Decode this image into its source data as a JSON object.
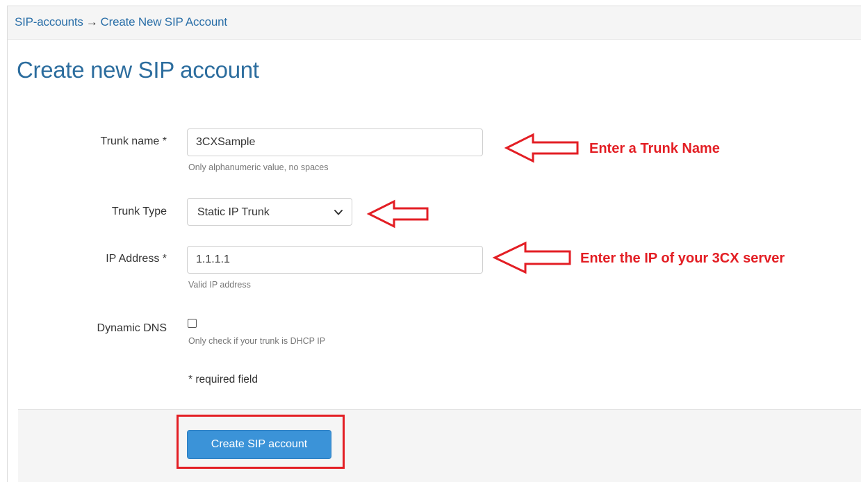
{
  "breadcrumb": {
    "parent": "SIP-accounts",
    "separator": "→",
    "current": "Create New SIP Account"
  },
  "page": {
    "title": "Create new SIP account"
  },
  "form": {
    "trunk_name": {
      "label": "Trunk name *",
      "value": "3CXSample",
      "help": "Only alphanumeric value, no spaces"
    },
    "trunk_type": {
      "label": "Trunk Type",
      "selected": "Static IP Trunk"
    },
    "ip_address": {
      "label": "IP Address *",
      "value": "1.1.1.1",
      "help": "Valid IP address"
    },
    "dynamic_dns": {
      "label": "Dynamic DNS",
      "checked": false,
      "help": "Only check if your trunk is DHCP IP"
    },
    "required_note": "* required field",
    "submit_label": "Create SIP account"
  },
  "annotations": {
    "trunk_name": "Enter a Trunk Name",
    "ip_address": "Enter the IP of your 3CX server",
    "color": "#e31e24"
  },
  "colors": {
    "title": "#2c6d9e",
    "link": "#2a6fa8",
    "button": "#3b93d8",
    "panel": "#f5f5f5"
  },
  "icons": {
    "select_chevron": "chevron-down-icon",
    "annotation_arrow": "arrow-left-icon"
  }
}
